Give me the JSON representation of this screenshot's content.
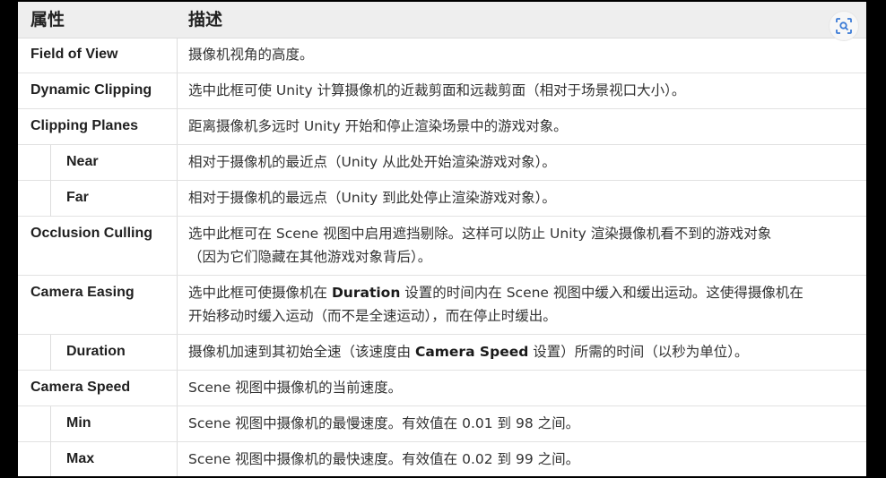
{
  "header": {
    "col_property": "属性",
    "col_description": "描述"
  },
  "rows": [
    {
      "name": "Field of View",
      "desc": "摄像机视角的高度。",
      "sub": false
    },
    {
      "name": "Dynamic Clipping",
      "desc": "选中此框可使 Unity 计算摄像机的近裁剪面和远裁剪面（相对于场景视口大小）。",
      "sub": false
    },
    {
      "name": "Clipping Planes",
      "desc": "距离摄像机多远时 Unity 开始和停止渲染场景中的游戏对象。",
      "sub": false
    },
    {
      "name": "Near",
      "desc": "相对于摄像机的最近点（Unity 从此处开始渲染游戏对象）。",
      "sub": true
    },
    {
      "name": "Far",
      "desc": "相对于摄像机的最远点（Unity 到此处停止渲染游戏对象）。",
      "sub": true
    },
    {
      "name": "Occlusion Culling",
      "desc_lines": [
        "选中此框可在 Scene 视图中启用遮挡剔除。这样可以防止 Unity 渲染摄像机看不到的游戏对象",
        "（因为它们隐藏在其他游戏对象背后）。"
      ],
      "sub": false
    },
    {
      "name": "Camera Easing",
      "desc_parts": [
        "选中此框可使摄像机在 ",
        "Duration",
        " 设置的时间内在 Scene 视图中缓入和缓出运动。这使得摄像机在",
        "开始移动时缓入运动（而不是全速运动），而在停止时缓出。"
      ],
      "sub": false
    },
    {
      "name": "Duration",
      "desc_parts": [
        "摄像机加速到其初始全速（该速度由 ",
        "Camera Speed",
        " 设置）所需的时间（以秒为单位）。"
      ],
      "sub": true
    },
    {
      "name": "Camera Speed",
      "desc": "Scene 视图中摄像机的当前速度。",
      "sub": false
    },
    {
      "name": "Min",
      "desc": "Scene 视图中摄像机的最慢速度。有效值在 0.01 到 98 之间。",
      "sub": true
    },
    {
      "name": "Max",
      "desc": "Scene 视图中摄像机的最快速度。有效值在 0.02 到 99 之间。",
      "sub": true
    }
  ],
  "icons": {
    "lens": "visual-search-icon"
  }
}
